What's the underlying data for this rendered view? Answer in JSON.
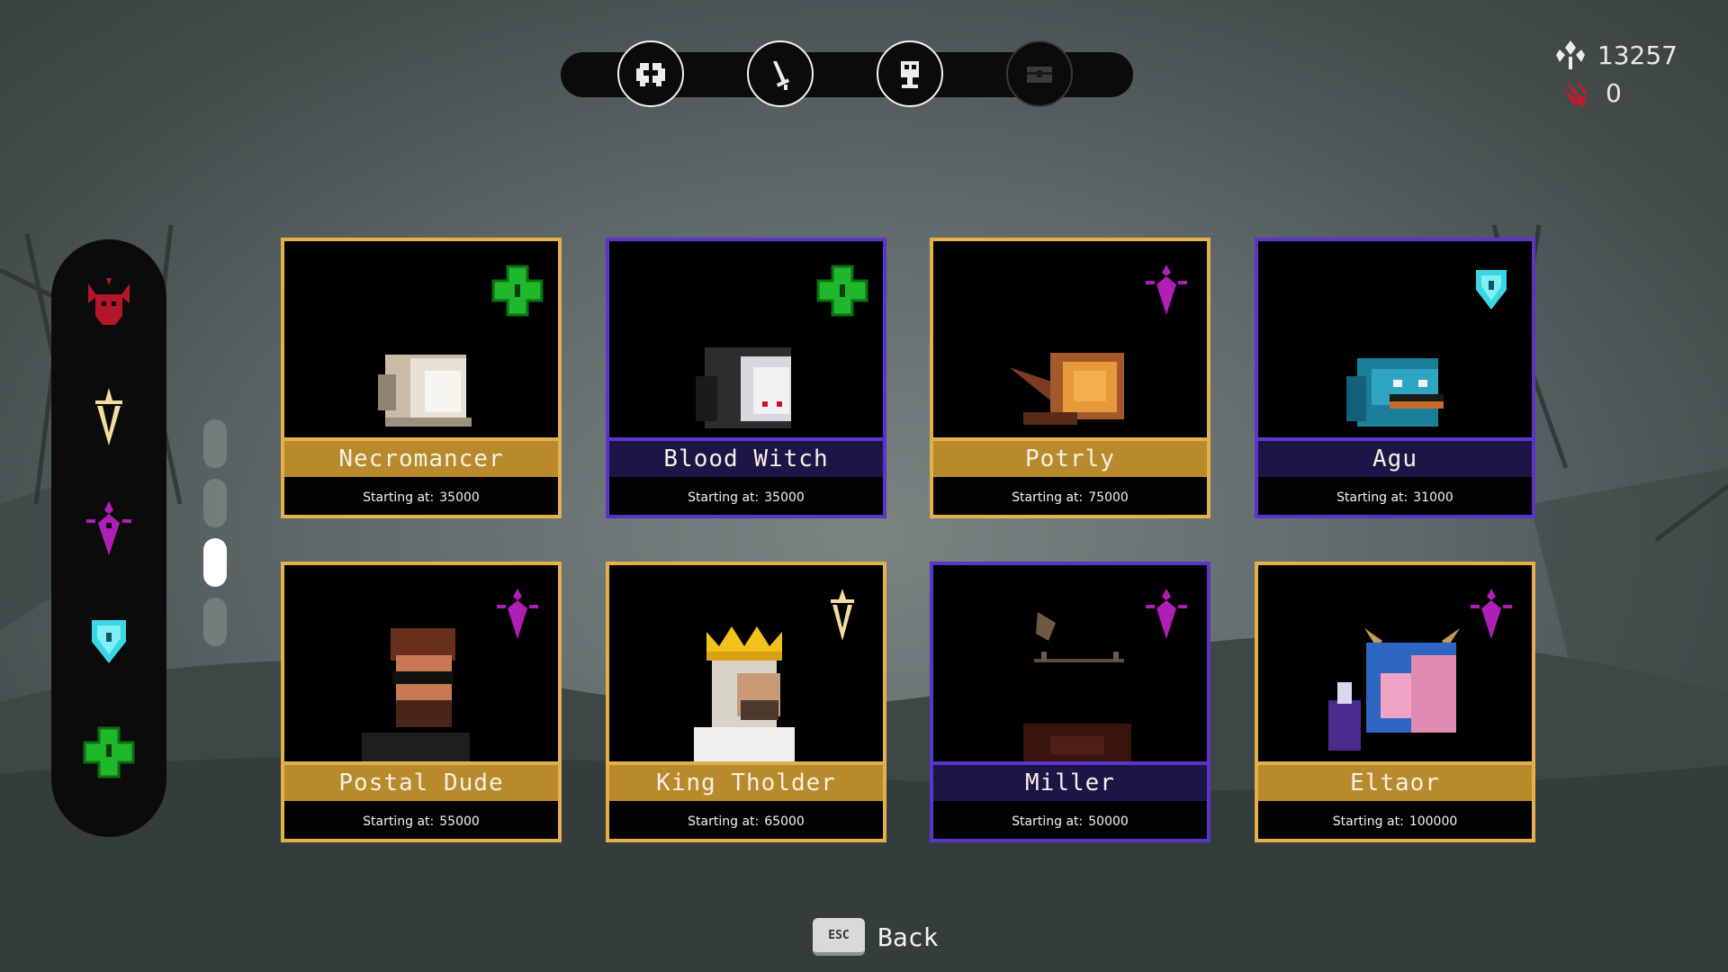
{
  "tabs": [
    {
      "name": "skull-helmet",
      "icon": "helmet-icon",
      "active": true
    },
    {
      "name": "weapon",
      "icon": "sword-icon",
      "active": true
    },
    {
      "name": "statue",
      "icon": "pedestal-icon",
      "active": true
    },
    {
      "name": "chest",
      "icon": "chest-icon",
      "active": false
    }
  ],
  "currency": {
    "souls": "13257",
    "blood": "0"
  },
  "rail": [
    {
      "icon": "demon-crest-icon",
      "color": "#b3162a"
    },
    {
      "icon": "dagger-icon",
      "color": "#f3dca0"
    },
    {
      "icon": "magenta-sigil-icon",
      "color": "#b01fb5"
    },
    {
      "icon": "cyan-shield-icon",
      "color": "#39d6e3"
    },
    {
      "icon": "green-cross-icon",
      "color": "#1fb82a"
    }
  ],
  "characters": [
    {
      "name": "Necromancer",
      "price_label": "Starting at:",
      "price": "35000",
      "badge": "green-cross-icon",
      "border": "gold"
    },
    {
      "name": "Blood Witch",
      "price_label": "Starting at:",
      "price": "35000",
      "badge": "green-cross-icon",
      "border": "purple"
    },
    {
      "name": "Potrly",
      "price_label": "Starting at:",
      "price": "75000",
      "badge": "magenta-sigil-icon",
      "border": "gold"
    },
    {
      "name": "Agu",
      "price_label": "Starting at:",
      "price": "31000",
      "badge": "cyan-shield-icon",
      "border": "purple"
    },
    {
      "name": "Postal Dude",
      "price_label": "Starting at:",
      "price": "55000",
      "badge": "magenta-sigil-icon",
      "border": "gold"
    },
    {
      "name": "King Tholder",
      "price_label": "Starting at:",
      "price": "65000",
      "badge": "dagger-icon",
      "border": "gold"
    },
    {
      "name": "Miller",
      "price_label": "Starting at:",
      "price": "50000",
      "badge": "magenta-sigil-icon",
      "border": "purple"
    },
    {
      "name": "Eltaor",
      "price_label": "Starting at:",
      "price": "100000",
      "badge": "magenta-sigil-icon",
      "border": "gold"
    }
  ],
  "footer": {
    "key": "ESC",
    "label": "Back"
  }
}
